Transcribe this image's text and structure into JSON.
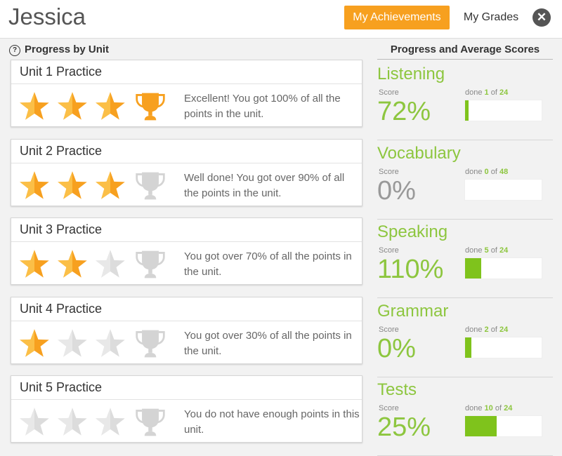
{
  "header": {
    "user_name": "Jessica",
    "tabs": [
      {
        "label": "My Achievements",
        "active": true
      },
      {
        "label": "My Grades",
        "active": false
      }
    ],
    "close_icon": "close-icon"
  },
  "left": {
    "section_title": "Progress by Unit",
    "help_icon": "?"
  },
  "right": {
    "section_title": "Progress and Average Scores"
  },
  "colors": {
    "accent_orange": "#f7a01f",
    "accent_green": "#8dc63f",
    "star_inactive": "#d9d9d9"
  },
  "units": [
    {
      "title": "Unit 1 Practice",
      "stars": 3,
      "trophy": true,
      "message": "Excellent! You got 100% of all the points in the unit."
    },
    {
      "title": "Unit 2 Practice",
      "stars": 3,
      "trophy": false,
      "message": "Well done! You got over 90% of all the points in the unit."
    },
    {
      "title": "Unit 3 Practice",
      "stars": 2,
      "trophy": false,
      "message": "You got over 70% of all the points in the unit."
    },
    {
      "title": "Unit 4 Practice",
      "stars": 1,
      "trophy": false,
      "message": "You got over 30% of all the points in the unit."
    },
    {
      "title": "Unit 5 Practice",
      "stars": 0,
      "trophy": false,
      "message": "You do not have enough points in this unit."
    }
  ],
  "skills": [
    {
      "name": "Listening",
      "score_label": "Score",
      "score": "72%",
      "score_active": true,
      "done_label": "done",
      "done": 1,
      "of_label": "of",
      "total": 24
    },
    {
      "name": "Vocabulary",
      "score_label": "Score",
      "score": "0%",
      "score_active": false,
      "done_label": "done",
      "done": 0,
      "of_label": "of",
      "total": 48
    },
    {
      "name": "Speaking",
      "score_label": "Score",
      "score": "110%",
      "score_active": true,
      "done_label": "done",
      "done": 5,
      "of_label": "of",
      "total": 24
    },
    {
      "name": "Grammar",
      "score_label": "Score",
      "score": "0%",
      "score_active": true,
      "done_label": "done",
      "done": 2,
      "of_label": "of",
      "total": 24
    },
    {
      "name": "Tests",
      "score_label": "Score",
      "score": "25%",
      "score_active": true,
      "done_label": "done",
      "done": 10,
      "of_label": "of",
      "total": 24
    }
  ]
}
